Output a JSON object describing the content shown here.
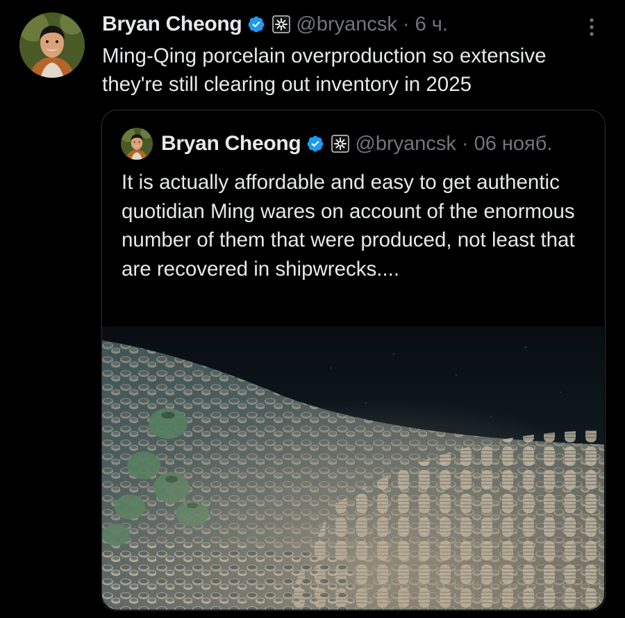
{
  "tweet": {
    "author_name": "Bryan Cheong",
    "handle": "@bryancsk",
    "separator": "·",
    "time": "6 ч.",
    "text": "Ming-Qing porcelain overproduction so extensive they're still clearing out inventory in 2025"
  },
  "quoted_tweet": {
    "author_name": "Bryan Cheong",
    "handle": "@bryancsk",
    "separator": "·",
    "time": "06 нояб.",
    "text": "It is actually affordable and easy to get authentic quotidian Ming wares on account of the enormous number of them that were produced, not least that are recovered in shipwrecks...."
  },
  "icons": {
    "verified": "verified-badge-icon",
    "affiliation": "affiliate-badge-icon",
    "more": "more-options-icon"
  },
  "colors": {
    "background": "#000000",
    "text_primary": "#e7e9ea",
    "text_secondary": "#71767b",
    "verified_blue": "#1d9bf0",
    "card_border": "#2f3336"
  }
}
